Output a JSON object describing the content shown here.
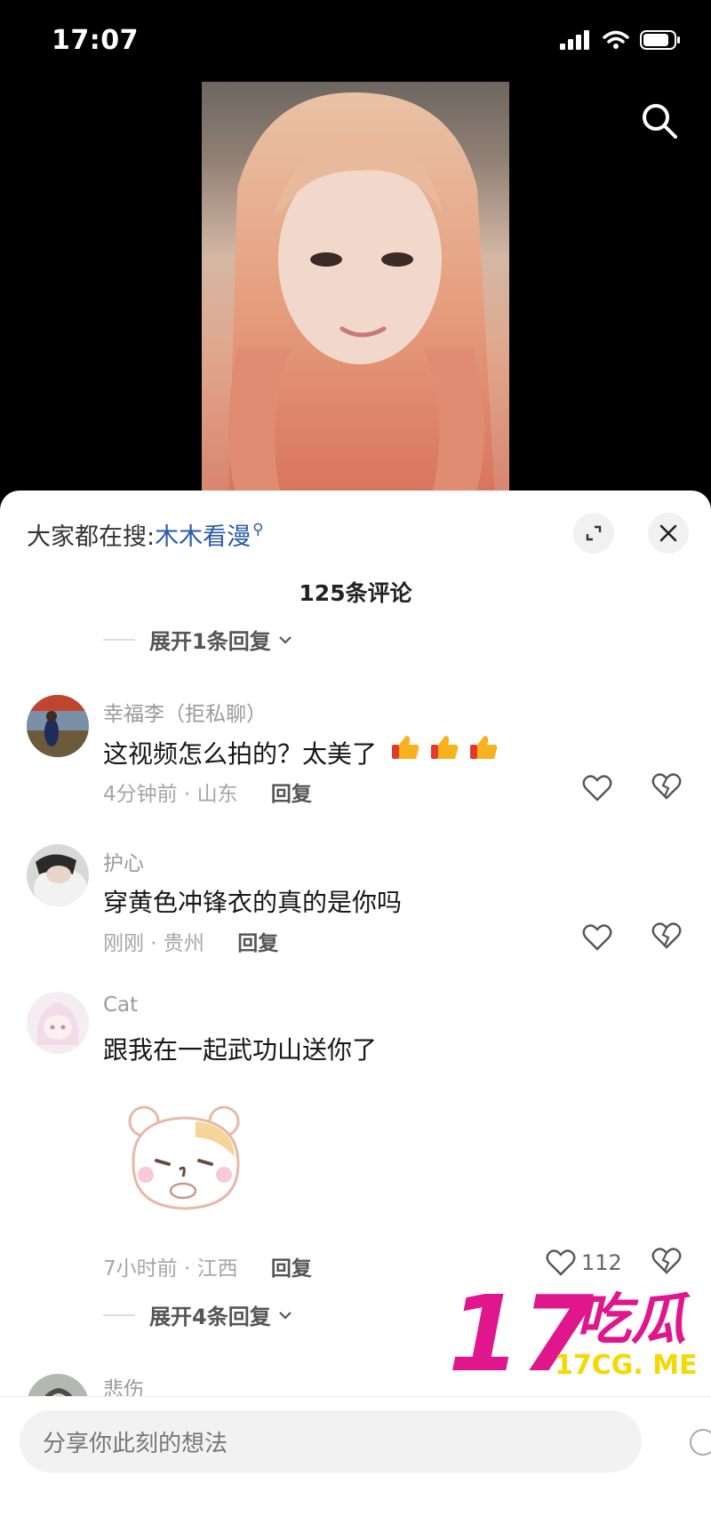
{
  "status_bar": {
    "time": "17:07"
  },
  "hot_search": {
    "prefix": "大家都在搜:",
    "keyword": "木木看漫"
  },
  "comments_header": {
    "count_label": "125条评论"
  },
  "expand_top": {
    "label": "展开1条回复"
  },
  "comments": [
    {
      "user": "幸福李（拒私聊）",
      "text": "这视频怎么拍的？太美了",
      "time_location": "4分钟前 · 山东",
      "reply_label": "回复"
    },
    {
      "user": "护心",
      "text": "穿黄色冲锋衣的真的是你吗",
      "time_location": "刚刚 · 贵州",
      "reply_label": "回复"
    },
    {
      "user": "Cat",
      "text": "跟我在一起武功山送你了",
      "time_location": "7小时前 · 江西",
      "reply_label": "回复",
      "likes": "112"
    },
    {
      "user": "悲伤"
    }
  ],
  "expand_cat": {
    "label": "展开4条回复"
  },
  "watermark": {
    "big": "17吃瓜",
    "small": "17CG. ME"
  },
  "input": {
    "placeholder": "分享你此刻的想法"
  },
  "colors": {
    "accent_link": "#2b5aa6",
    "watermark": "#e0168c",
    "watermark_yellow": "#f5d800"
  }
}
